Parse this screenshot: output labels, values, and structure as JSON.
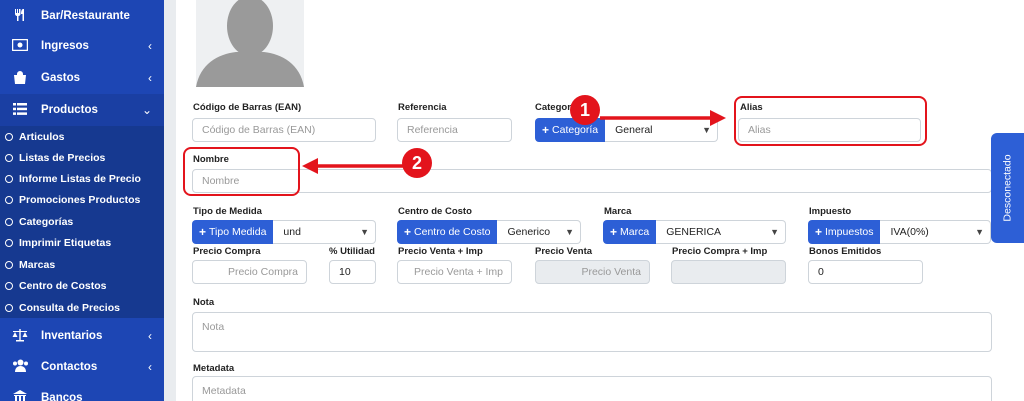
{
  "sidebar": {
    "items": [
      {
        "label": "Bar/Restaurante",
        "icon": "fork-knife-icon",
        "chevron": ""
      },
      {
        "label": "Ingresos",
        "icon": "money-icon",
        "chevron": "‹"
      },
      {
        "label": "Gastos",
        "icon": "shopping-bag-icon",
        "chevron": "‹"
      },
      {
        "label": "Productos",
        "icon": "list-icon",
        "chevron": "⌄"
      },
      {
        "label": "Inventarios",
        "icon": "scale-icon",
        "chevron": "‹"
      },
      {
        "label": "Contactos",
        "icon": "users-icon",
        "chevron": "‹"
      },
      {
        "label": "Bancos",
        "icon": "bank-icon",
        "chevron": ""
      }
    ],
    "submenu": [
      {
        "label": "Articulos"
      },
      {
        "label": "Listas de Precios"
      },
      {
        "label": "Informe Listas de Precio"
      },
      {
        "label": "Promociones Productos"
      },
      {
        "label": "Categorías"
      },
      {
        "label": "Imprimir Etiquetas"
      },
      {
        "label": "Marcas"
      },
      {
        "label": "Centro de Costos"
      },
      {
        "label": "Consulta de Precios"
      }
    ]
  },
  "form": {
    "ean": {
      "label": "Código de Barras (EAN)",
      "placeholder": "Código de Barras (EAN)"
    },
    "referencia": {
      "label": "Referencia",
      "placeholder": "Referencia"
    },
    "categoria": {
      "label": "Categor",
      "button": "Categoría",
      "value": "General"
    },
    "alias": {
      "label": "Alias",
      "placeholder": "Alias"
    },
    "nombre": {
      "label": "Nombre",
      "placeholder": "Nombre"
    },
    "tipo_medida": {
      "label": "Tipo de Medida",
      "button": "Tipo Medida",
      "value": "und"
    },
    "centro_costo": {
      "label": "Centro de Costo",
      "button": "Centro de Costo",
      "value": "Generico"
    },
    "marca": {
      "label": "Marca",
      "button": "Marca",
      "value": "GENERICA"
    },
    "impuesto": {
      "label": "Impuesto",
      "button": "Impuestos",
      "value": "IVA(0%)"
    },
    "precio_compra": {
      "label": "Precio Compra",
      "placeholder": "Precio Compra"
    },
    "utilidad": {
      "label": "% Utilidad",
      "value": "10"
    },
    "precio_venta_imp": {
      "label": "Precio Venta + Imp",
      "placeholder": "Precio Venta + Imp"
    },
    "precio_venta": {
      "label": "Precio Venta",
      "placeholder": "Precio Venta"
    },
    "precio_compra_imp": {
      "label": "Precio Compra + Imp"
    },
    "bonos": {
      "label": "Bonos Emitidos",
      "value": "0"
    },
    "nota": {
      "label": "Nota",
      "placeholder": "Nota"
    },
    "metadata": {
      "label": "Metadata",
      "placeholder": "Metadata"
    }
  },
  "annotations": {
    "marker1": "1",
    "marker2": "2",
    "color": "#e3141c"
  },
  "side_tab": {
    "label": "Desconectado"
  },
  "colors": {
    "sidebar": "#1d46b4",
    "accent": "#2d5fd6"
  }
}
